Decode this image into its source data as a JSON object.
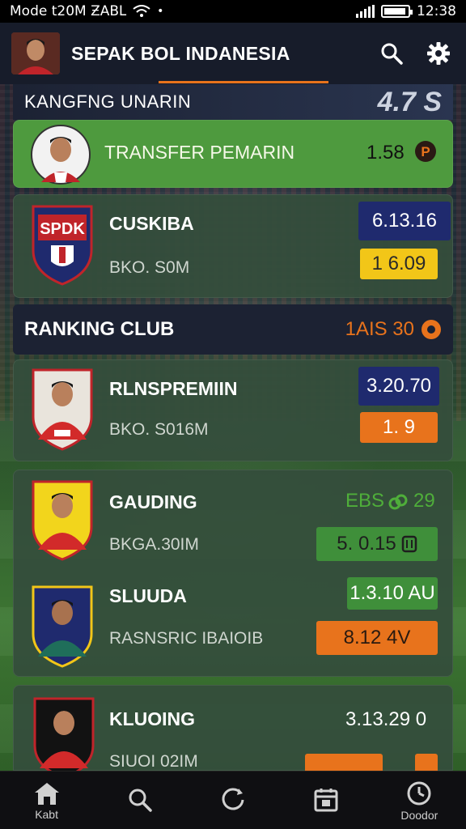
{
  "status_bar": {
    "left_text": "Mode t20M ƵABԼ",
    "time": "12:38"
  },
  "header": {
    "title": "SEPAK BOL INDANESIA"
  },
  "partial_banner": {
    "label": "KANGFNG UNARIN",
    "score": "4.7 S"
  },
  "transfer_row": {
    "label": "TRANSFER PEMARIN",
    "value": "1.58"
  },
  "club_card": {
    "name": "CUSKIBA",
    "sub": "BKO. S0M",
    "badge_top": "6.13.16",
    "badge_bottom": "1  6.09",
    "crest_text": "SPDK"
  },
  "ranking_bar": {
    "title": "RANKING CLUB",
    "value": "1AIS 30"
  },
  "player1": {
    "name": "RLNSPREMIIN",
    "sub": "BKO. S016M",
    "badge_top": "3.20.70",
    "badge_bottom": "1. 9"
  },
  "group_card": {
    "p1": {
      "name": "GAUDING",
      "sub": "BKGA.30IM",
      "top_value": "EBS",
      "top_value2": "29",
      "badge": "5. 0.15"
    },
    "p2": {
      "name": "SLUUDA",
      "sub": "RASNSRIC IBAIOIB",
      "badge_top": "1.3.10 AU",
      "badge_bottom": "8.12 4V"
    }
  },
  "last_card": {
    "name": "KLUOING",
    "sub": "SIUOI 02IM",
    "value": "3.13.29 0"
  },
  "nav": [
    {
      "label": "Kabt",
      "icon": "home-icon"
    },
    {
      "label": "",
      "icon": "search-icon"
    },
    {
      "label": "",
      "icon": "refresh-icon"
    },
    {
      "label": "",
      "icon": "calendar-icon"
    },
    {
      "label": "Doodor",
      "icon": "clock-icon"
    }
  ],
  "colors": {
    "green_badge": "#3f8f3a",
    "orange_badge": "#e8731c",
    "navy_badge": "#1f2a6e",
    "yellow_badge": "#f2c618"
  }
}
